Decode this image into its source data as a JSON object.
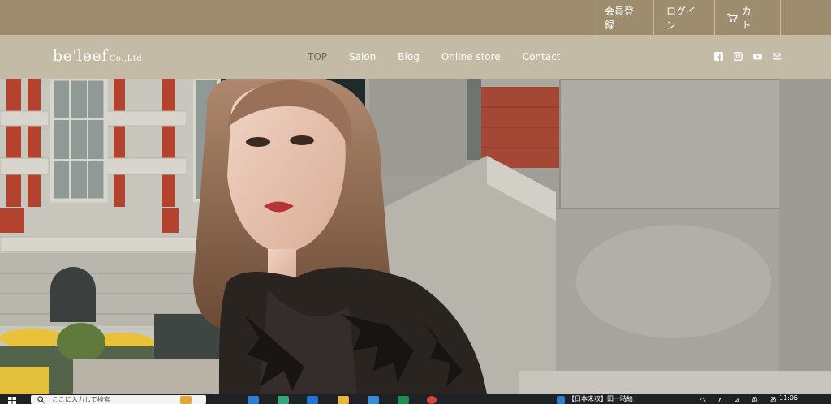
{
  "topbar": {
    "register": "会員登録",
    "login": "ログイン",
    "cart": "カート"
  },
  "header": {
    "logo_main": "be'leef",
    "logo_sub": "Co.,Ltd",
    "nav": [
      "TOP",
      "Salon",
      "Blog",
      "Online store",
      "Contact"
    ],
    "active_nav": "TOP",
    "social": [
      "facebook-icon",
      "instagram-icon",
      "youtube-icon",
      "mail-icon"
    ]
  },
  "taskbar": {
    "search_placeholder": "ここに入力して検索",
    "task_title": "【日本未収】田一時給",
    "clock": "11:06",
    "tray": "へ ∧ ⊿ ゐ あ"
  },
  "colors": {
    "topbar": "#9d8d6e",
    "header": "#c4bba6",
    "active_nav": "#6f6a60"
  }
}
